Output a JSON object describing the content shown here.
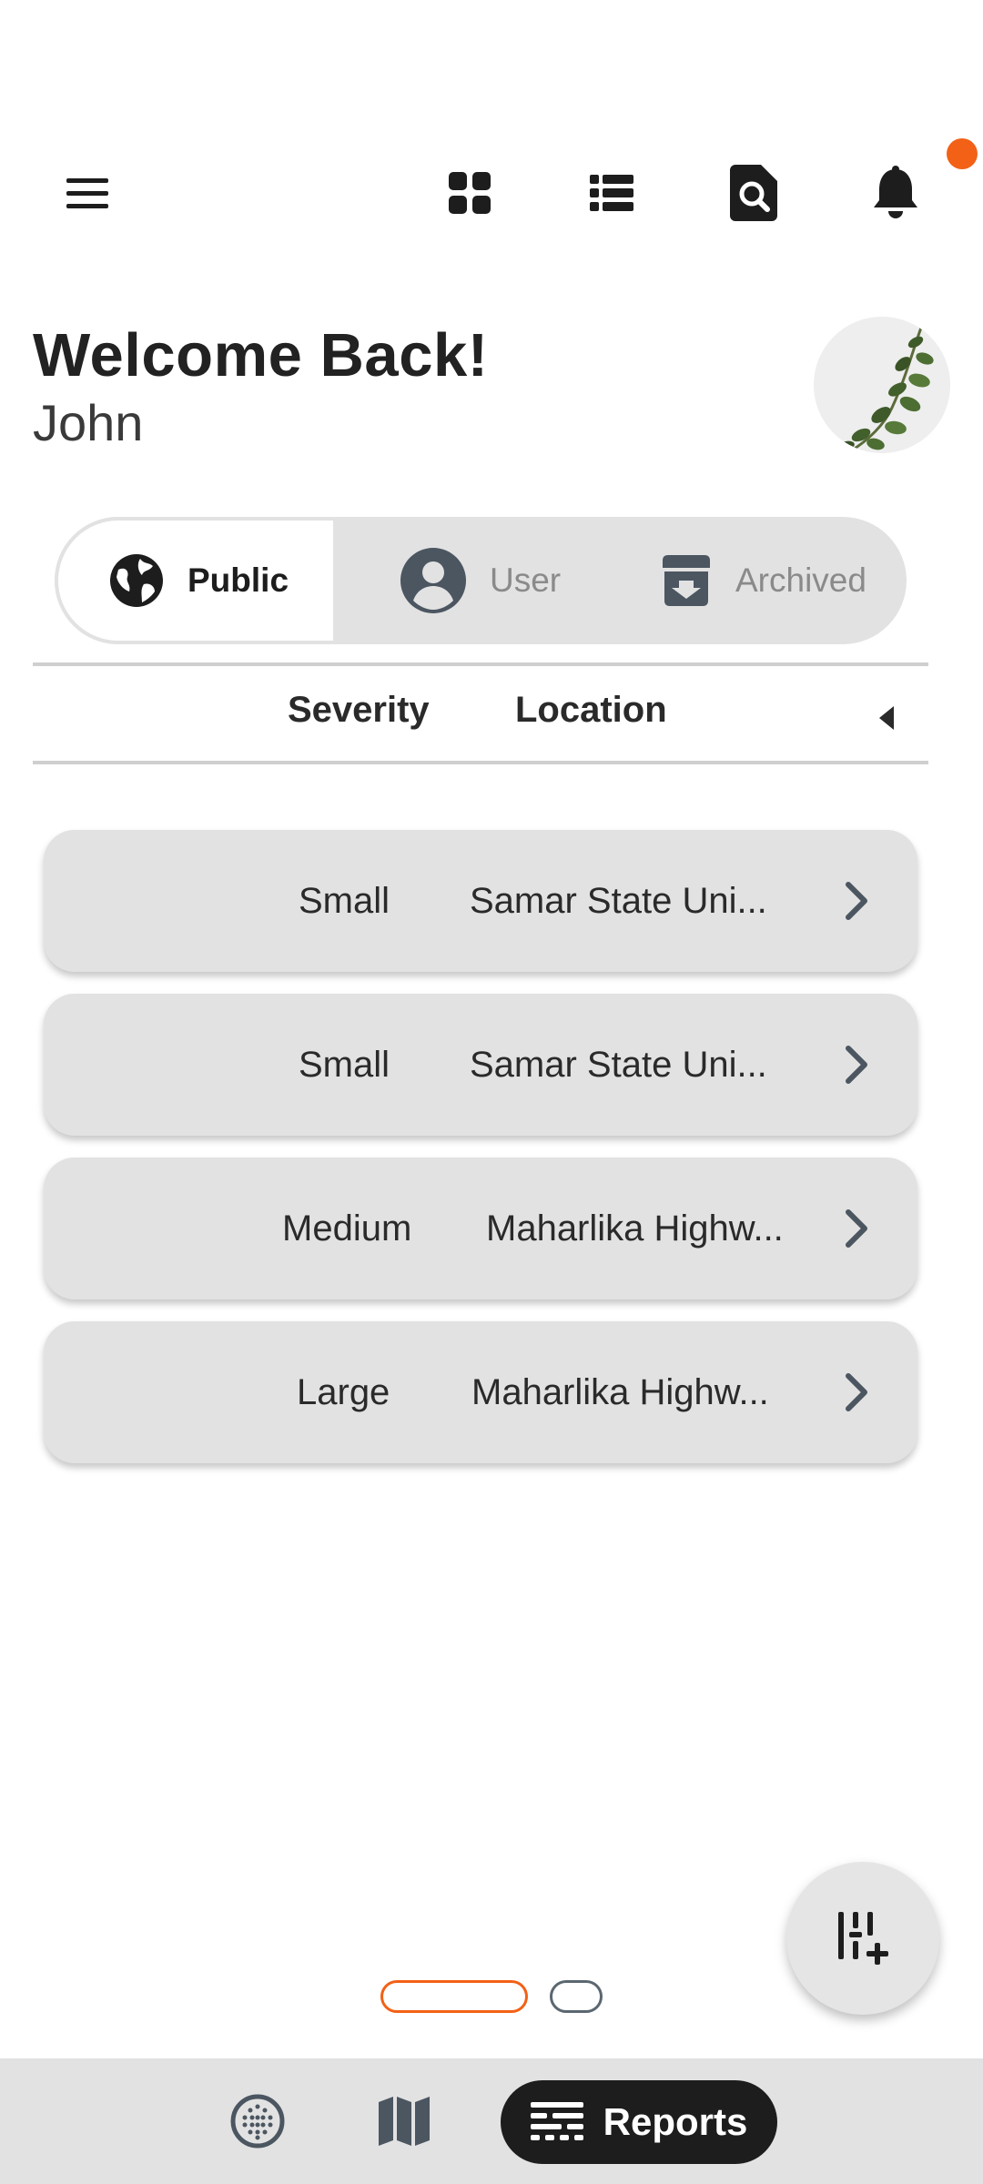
{
  "header": {
    "welcome": "Welcome Back!",
    "username": "John"
  },
  "topbar": {
    "icons": [
      "menu-icon",
      "grid-icon",
      "list-icon",
      "search-document-icon",
      "bell-icon"
    ],
    "notification_color": "#f26116"
  },
  "filters": {
    "items": [
      {
        "label": "Public",
        "icon": "globe-icon",
        "active": true
      },
      {
        "label": "User",
        "icon": "user-circle-icon",
        "active": false
      },
      {
        "label": "Archived",
        "icon": "archive-icon",
        "active": false
      }
    ]
  },
  "table": {
    "columns": [
      "Severity",
      "Location"
    ],
    "rows": [
      {
        "severity": "Small",
        "location": "Samar State Uni..."
      },
      {
        "severity": "Small",
        "location": "Samar State Uni..."
      },
      {
        "severity": "Medium",
        "location": "Maharlika Highw..."
      },
      {
        "severity": "Large",
        "location": "Maharlika Highw..."
      }
    ]
  },
  "bottom_nav": {
    "items": [
      {
        "icon": "globe-grid-icon"
      },
      {
        "icon": "map-icon"
      },
      {
        "icon": "reports-icon",
        "label": "Reports",
        "active": true
      }
    ]
  },
  "colors": {
    "accent": "#f26116",
    "card": "#e2e2e2",
    "dark": "#1d1d1d"
  }
}
